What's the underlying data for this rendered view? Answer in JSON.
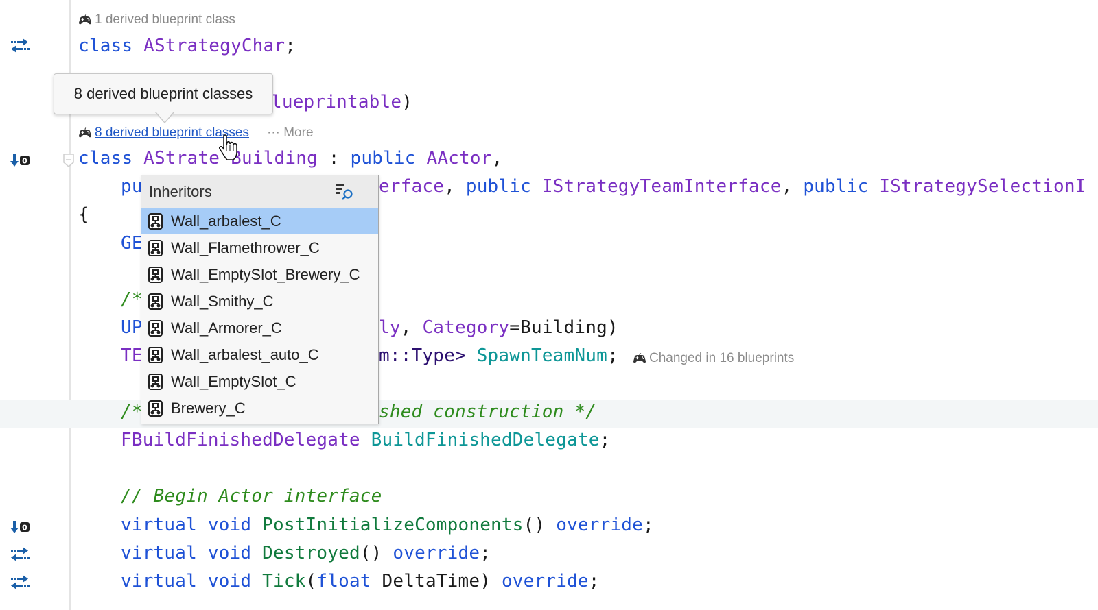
{
  "hints": {
    "derived_one": "1 derived blueprint class",
    "derived_eight_link": "8 derived blueprint classes",
    "more": "More",
    "changed": "Changed in 16 blueprints"
  },
  "tooltip": {
    "text": "8 derived blueprint classes"
  },
  "popup": {
    "title": "Inheritors",
    "items": [
      {
        "label": "Wall_arbalest_C",
        "selected": true
      },
      {
        "label": "Wall_Flamethrower_C"
      },
      {
        "label": "Wall_EmptySlot_Brewery_C"
      },
      {
        "label": "Wall_Smithy_C"
      },
      {
        "label": "Wall_Armorer_C"
      },
      {
        "label": "Wall_arbalest_auto_C"
      },
      {
        "label": "Wall_EmptySlot_C"
      },
      {
        "label": "Brewery_C"
      }
    ]
  },
  "code": {
    "l1": {
      "kw": "class",
      "name": "AStrategyChar",
      "end": ";"
    },
    "l2": {
      "tail": "lueprintable",
      "end": ")"
    },
    "l3": {
      "kw": "class",
      "name_a": "AStrate",
      "name_b": "Building",
      "colon": " : ",
      "pub": "public",
      "base": "AActor",
      "end": ","
    },
    "l4": {
      "pre": "pu",
      "tail": "erface",
      "c1": ", ",
      "pub1": "public",
      "t1": "IStrategyTeamInterface",
      "c2": ", ",
      "pub2": "public",
      "t2": "IStrategySelectionI"
    },
    "l5": {
      "brace": "{"
    },
    "l6": {
      "pre": "GE"
    },
    "l7": {
      "pre": "/*"
    },
    "l8": {
      "pre": "UP",
      "tail": "ly",
      "comma": ", ",
      "cat": "Category",
      "eq": "=",
      "val": "Building",
      "end": ")"
    },
    "l9": {
      "pre": "TE",
      "tail": "m::Type>",
      "field": "SpawnTeamNum",
      "end": ";"
    },
    "l10": {
      "pre": "/*",
      "tail": "shed construction */"
    },
    "l11": {
      "type": "FBuildFinishedDelegate",
      "field": "BuildFinishedDelegate",
      "end": ";"
    },
    "l12": {
      "cmt": "// Begin Actor interface"
    },
    "l13": {
      "kw1": "virtual",
      "kw2": "void",
      "fn": "PostInitializeComponents",
      "paren": "()",
      "ov": "override",
      "end": ";"
    },
    "l14": {
      "kw1": "virtual",
      "kw2": "void",
      "fn": "Destroyed",
      "paren": "()",
      "ov": "override",
      "end": ";"
    },
    "l15": {
      "kw1": "virtual",
      "kw2": "void",
      "fn": "Tick",
      "p1": "(",
      "ptype": "float",
      "pname": "DeltaTime",
      "p2": ")",
      "ov": "override",
      "end": ";"
    }
  },
  "gutter": {
    "override_badge": "0"
  },
  "colors": {
    "keyword": "#1f52d6",
    "type": "#7a2fc2",
    "field": "#0d9696",
    "function": "#117a3d",
    "comment": "#2e8b1d",
    "selection": "#a6ccf7",
    "link": "#2058c6"
  }
}
